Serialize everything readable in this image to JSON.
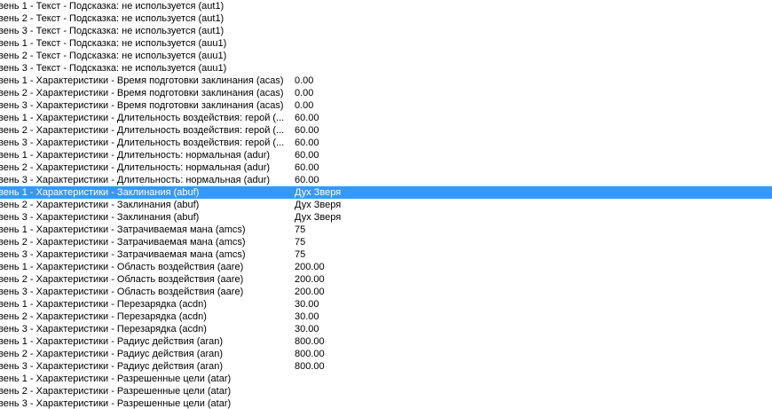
{
  "list": {
    "selected_index": 15,
    "rows": [
      {
        "field": "вень 1 - Текст - Подсказка: не используется (aut1)",
        "value": ""
      },
      {
        "field": "вень 2 - Текст - Подсказка: не используется (aut1)",
        "value": ""
      },
      {
        "field": "вень 3 - Текст - Подсказка: не используется (aut1)",
        "value": ""
      },
      {
        "field": "вень 1 - Текст - Подсказка: не используется (auu1)",
        "value": ""
      },
      {
        "field": "вень 2 - Текст - Подсказка: не используется (auu1)",
        "value": ""
      },
      {
        "field": "вень 3 - Текст - Подсказка: не используется (auu1)",
        "value": ""
      },
      {
        "field": "вень 1 - Характеристики - Время подготовки заклинания (acas)",
        "value": "0.00"
      },
      {
        "field": "вень 2 - Характеристики - Время подготовки заклинания (acas)",
        "value": "0.00"
      },
      {
        "field": "вень 3 - Характеристики - Время подготовки заклинания (acas)",
        "value": "0.00"
      },
      {
        "field": "вень 1 - Характеристики - Длительность воздействия: герой (...",
        "value": "60.00"
      },
      {
        "field": "вень 2 - Характеристики - Длительность воздействия: герой (...",
        "value": "60.00"
      },
      {
        "field": "вень 3 - Характеристики - Длительность воздействия: герой (...",
        "value": "60.00"
      },
      {
        "field": "вень 1 - Характеристики - Длительность: нормальная (adur)",
        "value": "60.00"
      },
      {
        "field": "вень 2 - Характеристики - Длительность: нормальная (adur)",
        "value": "60.00"
      },
      {
        "field": "вень 3 - Характеристики - Длительность: нормальная (adur)",
        "value": "60.00"
      },
      {
        "field": "вень 1 - Характеристики - Заклинания (abuf)",
        "value": "Дух Зверя"
      },
      {
        "field": "вень 2 - Характеристики - Заклинания (abuf)",
        "value": "Дух Зверя"
      },
      {
        "field": "вень 3 - Характеристики - Заклинания (abuf)",
        "value": "Дух Зверя"
      },
      {
        "field": "вень 1 - Характеристики - Затрачиваемая мана (amcs)",
        "value": "75"
      },
      {
        "field": "вень 2 - Характеристики - Затрачиваемая мана (amcs)",
        "value": "75"
      },
      {
        "field": "вень 3 - Характеристики - Затрачиваемая мана (amcs)",
        "value": "75"
      },
      {
        "field": "вень 1 - Характеристики - Область воздействия (aare)",
        "value": "200.00"
      },
      {
        "field": "вень 2 - Характеристики - Область воздействия (aare)",
        "value": "200.00"
      },
      {
        "field": "вень 3 - Характеристики - Область воздействия (aare)",
        "value": "200.00"
      },
      {
        "field": "вень 1 - Характеристики - Перезарядка (acdn)",
        "value": "30.00"
      },
      {
        "field": "вень 2 - Характеристики - Перезарядка (acdn)",
        "value": "30.00"
      },
      {
        "field": "вень 3 - Характеристики - Перезарядка (acdn)",
        "value": "30.00"
      },
      {
        "field": "вень 1 - Характеристики - Радиус действия (aran)",
        "value": "800.00"
      },
      {
        "field": "вень 2 - Характеристики - Радиус действия (aran)",
        "value": "800.00"
      },
      {
        "field": "вень 3 - Характеристики - Радиус действия (aran)",
        "value": "800.00"
      },
      {
        "field": "вень 1 - Характеристики - Разрешенные цели (atar)",
        "value": ""
      },
      {
        "field": "вень 2 - Характеристики - Разрешенные цели (atar)",
        "value": ""
      },
      {
        "field": "вень 3 - Характеристики - Разрешенные цели (atar)",
        "value": ""
      }
    ]
  }
}
